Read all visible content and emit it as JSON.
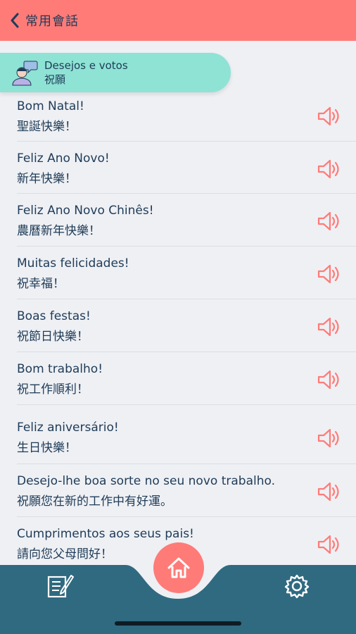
{
  "header": {
    "title": "常用會話"
  },
  "category": {
    "title_pt": "Desejos e votos",
    "title_zh": "祝願"
  },
  "phrases": [
    {
      "pt": "Bom Natal!",
      "zh": "聖誕快樂！"
    },
    {
      "pt": "Feliz Ano Novo!",
      "zh": "新年快樂！"
    },
    {
      "pt": "Feliz Ano Novo Chinês!",
      "zh": "農曆新年快樂！"
    },
    {
      "pt": "Muitas felicidades!",
      "zh": "祝幸福！"
    },
    {
      "pt": "Boas festas!",
      "zh": "祝節日快樂！"
    },
    {
      "pt": "Bom trabalho!",
      "zh": "祝工作順利！"
    },
    {
      "pt": "Feliz aniversário!",
      "zh": "生日快樂！"
    },
    {
      "pt": "Desejo-lhe boa sorte no seu novo trabalho.",
      "zh": "祝願您在新的工作中有好運。"
    },
    {
      "pt": "Cumprimentos aos seus pais!",
      "zh": "請向您父母問好！"
    }
  ],
  "icons": {
    "back": "chevron-left-icon",
    "category": "person-speech-icon",
    "speaker": "speaker-icon",
    "home": "home-icon",
    "notes": "notepad-pen-icon",
    "settings": "gear-icon"
  },
  "colors": {
    "header": "#ff7b78",
    "category": "#8ee3d4",
    "text": "#1f3b57",
    "speaker": "#ff7b78",
    "bottom_bar": "#2f6a80",
    "background": "#eef0f4"
  }
}
